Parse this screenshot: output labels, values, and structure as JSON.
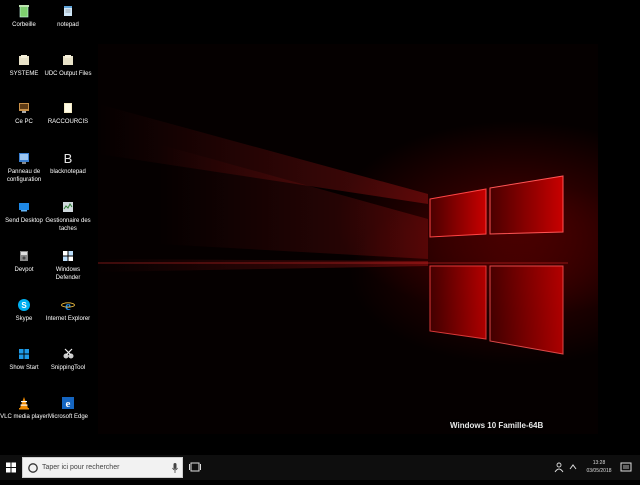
{
  "desktop": {
    "icons_col1": [
      {
        "label": "Corbeille",
        "icon": "recycle-bin-icon"
      },
      {
        "label": "SYSTEME",
        "icon": "folder-icon"
      },
      {
        "label": "Ce PC",
        "icon": "computer-icon"
      },
      {
        "label": "Panneau de configuration",
        "icon": "control-panel-icon"
      },
      {
        "label": "Send Desktop",
        "icon": "monitor-icon"
      },
      {
        "label": "Devpot",
        "icon": "devpot-icon"
      },
      {
        "label": "Skype",
        "icon": "skype-icon"
      },
      {
        "label": "Show Start",
        "icon": "windows-start-icon"
      },
      {
        "label": "VLC media player",
        "icon": "vlc-cone-icon"
      }
    ],
    "icons_col2": [
      {
        "label": "notepad",
        "icon": "notepad-icon"
      },
      {
        "label": "UDC Output Files",
        "icon": "folder-icon"
      },
      {
        "label": "RACCOURCIS",
        "icon": "folder-icon"
      },
      {
        "label": "blacknotepad",
        "icon": "blacknotepad-b-icon"
      },
      {
        "label": "Gestionnaire des taches",
        "icon": "task-manager-icon"
      },
      {
        "label": "Windows Defender",
        "icon": "windows-defender-icon"
      },
      {
        "label": "Internet Explorer",
        "icon": "internet-explorer-icon"
      },
      {
        "label": "SnippingTool",
        "icon": "snipping-tool-icon"
      },
      {
        "label": "Microsoft Edge",
        "icon": "edge-icon"
      }
    ],
    "edition_text": "Windows 10 Famille-64B"
  },
  "taskbar": {
    "search_placeholder": "Taper ici pour rechercher",
    "clock_time": "13:28",
    "clock_date": "03/05/2018"
  },
  "colors": {
    "accent_red": "#e01010",
    "taskbar_bg": "#0e0e0e",
    "search_bg": "#f2f2f2"
  }
}
